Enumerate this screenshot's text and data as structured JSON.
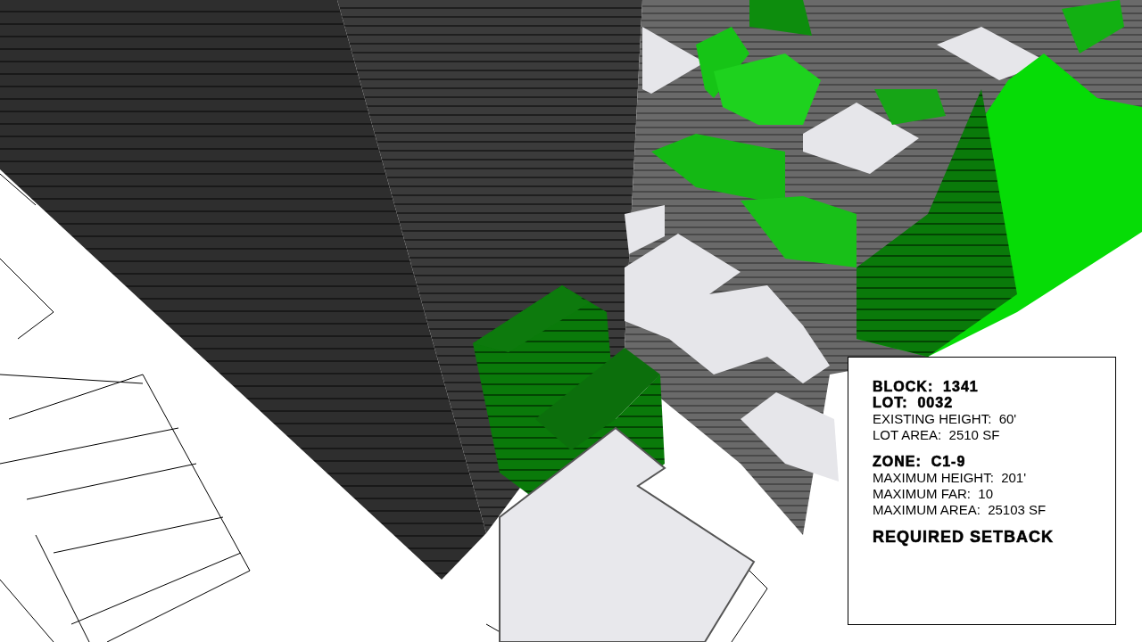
{
  "info_panel": {
    "sections": [
      {
        "lines": [
          {
            "kind": "heading",
            "text": "BLOCK:  1341"
          },
          {
            "kind": "heading",
            "text": "LOT:  0032"
          },
          {
            "kind": "detail",
            "text": "EXISTING HEIGHT:  60'"
          },
          {
            "kind": "detail",
            "text": "LOT AREA:  2510 SF"
          }
        ]
      },
      {
        "lines": [
          {
            "kind": "heading",
            "text": "ZONE:  C1-9"
          },
          {
            "kind": "detail",
            "text": "MAXIMUM HEIGHT:  201'"
          },
          {
            "kind": "detail",
            "text": "MAXIMUM FAR:  10"
          },
          {
            "kind": "detail",
            "text": "MAXIMUM AREA:  25103 SF"
          }
        ]
      },
      {
        "lines": [
          {
            "kind": "heading",
            "text": "REQUIRED SETBACK"
          }
        ]
      }
    ]
  }
}
